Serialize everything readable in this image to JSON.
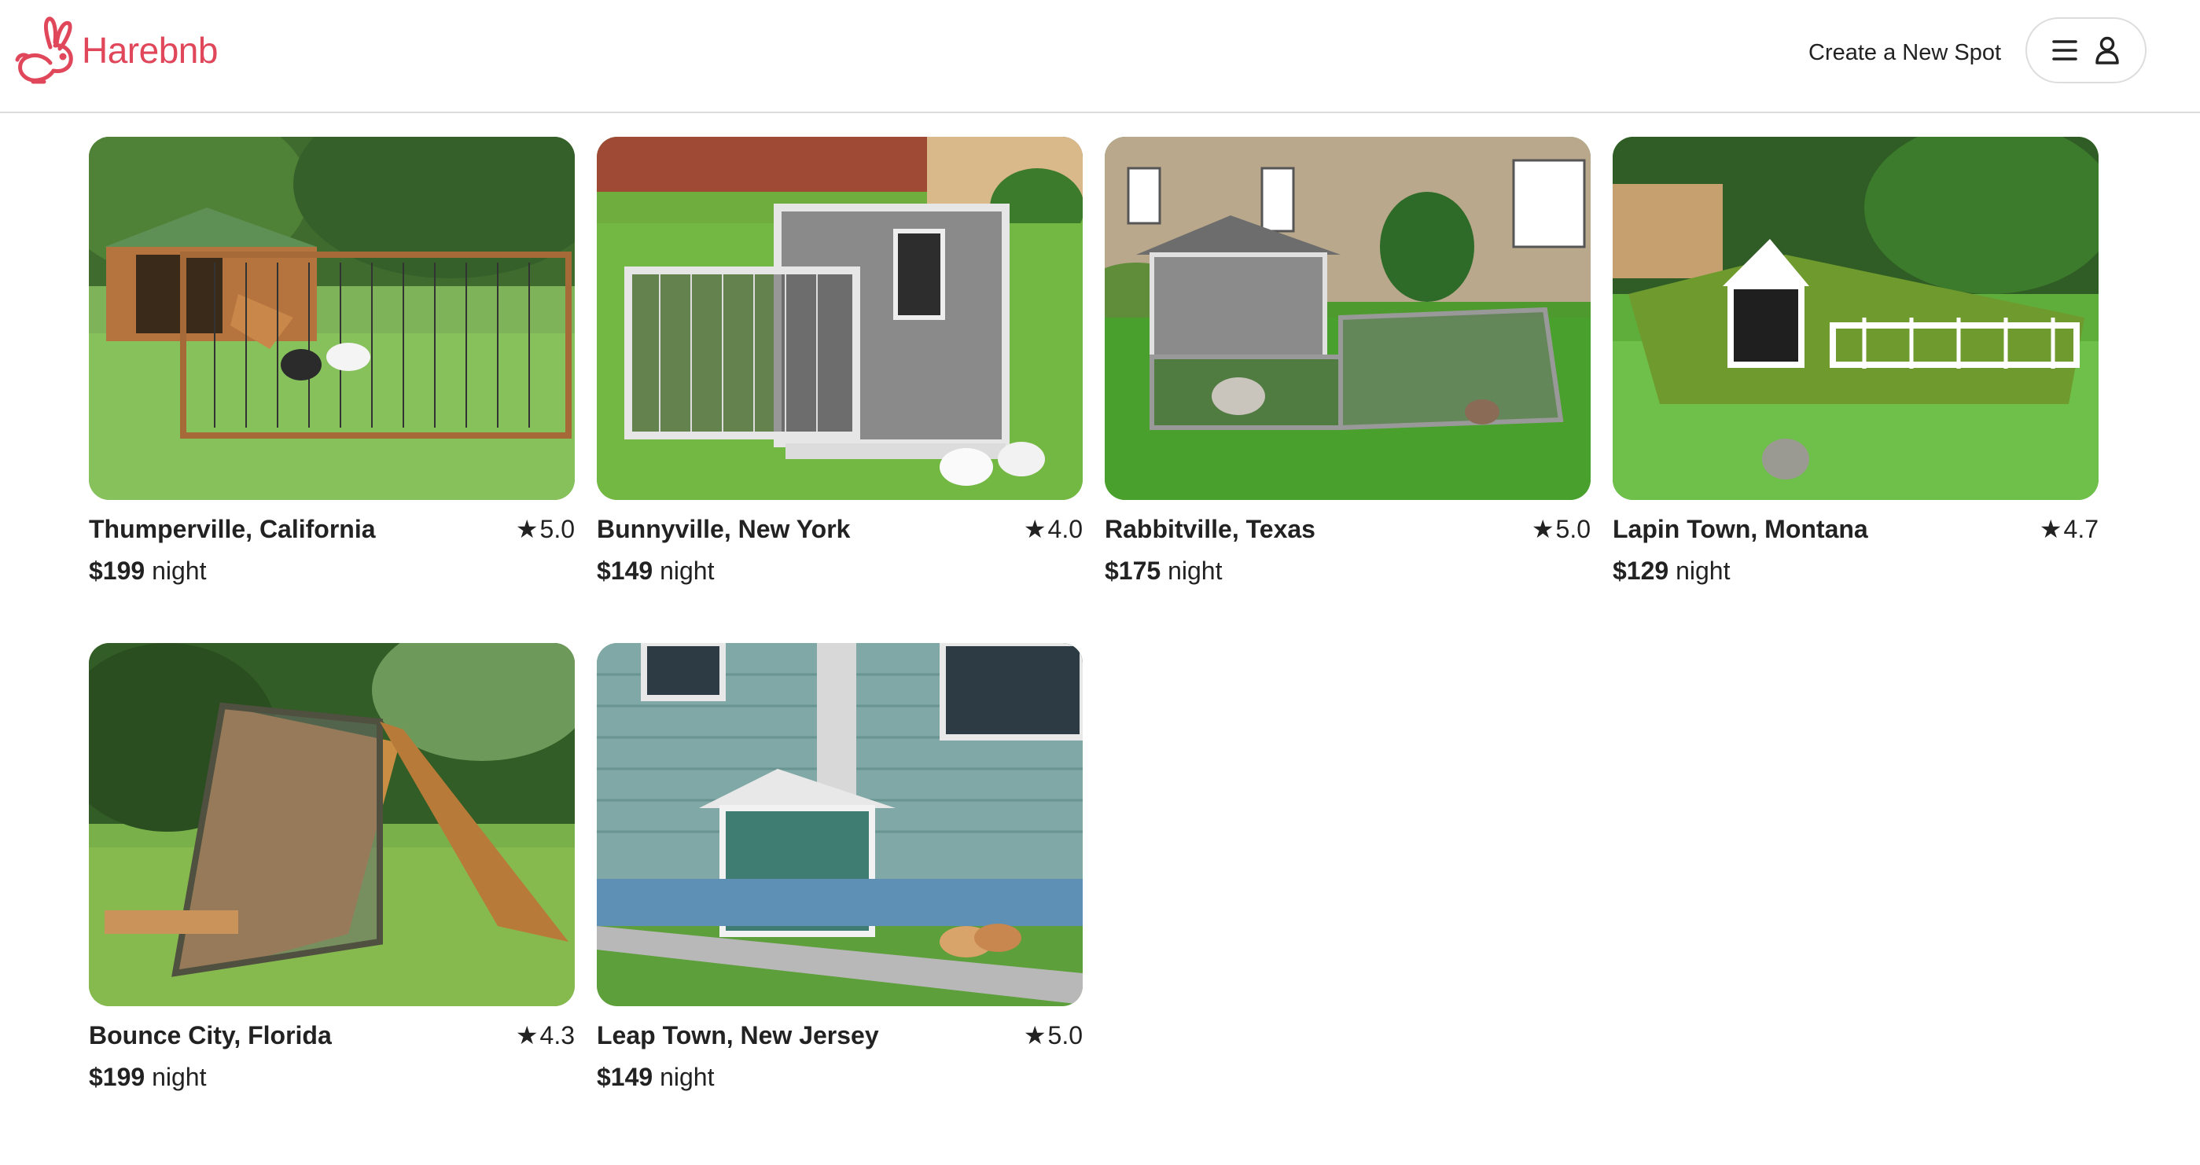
{
  "header": {
    "logo_text": "Harebnb",
    "create_spot_label": "Create a New Spot",
    "menu_icon": "hamburger-icon",
    "user_icon": "user-icon",
    "brand_color": "#e0475a"
  },
  "spots": [
    {
      "city": "Thumperville, California",
      "rating": "5.0",
      "price": "$199",
      "unit": "night"
    },
    {
      "city": "Bunnyville, New York",
      "rating": "4.0",
      "price": "$149",
      "unit": "night"
    },
    {
      "city": "Rabbitville, Texas",
      "rating": "5.0",
      "price": "$175",
      "unit": "night"
    },
    {
      "city": "Lapin Town, Montana",
      "rating": "4.7",
      "price": "$129",
      "unit": "night"
    },
    {
      "city": "Bounce City, Florida",
      "rating": "4.3",
      "price": "$199",
      "unit": "night"
    },
    {
      "city": "Leap Town, New Jersey",
      "rating": "5.0",
      "price": "$149",
      "unit": "night"
    }
  ],
  "star_glyph": "★"
}
